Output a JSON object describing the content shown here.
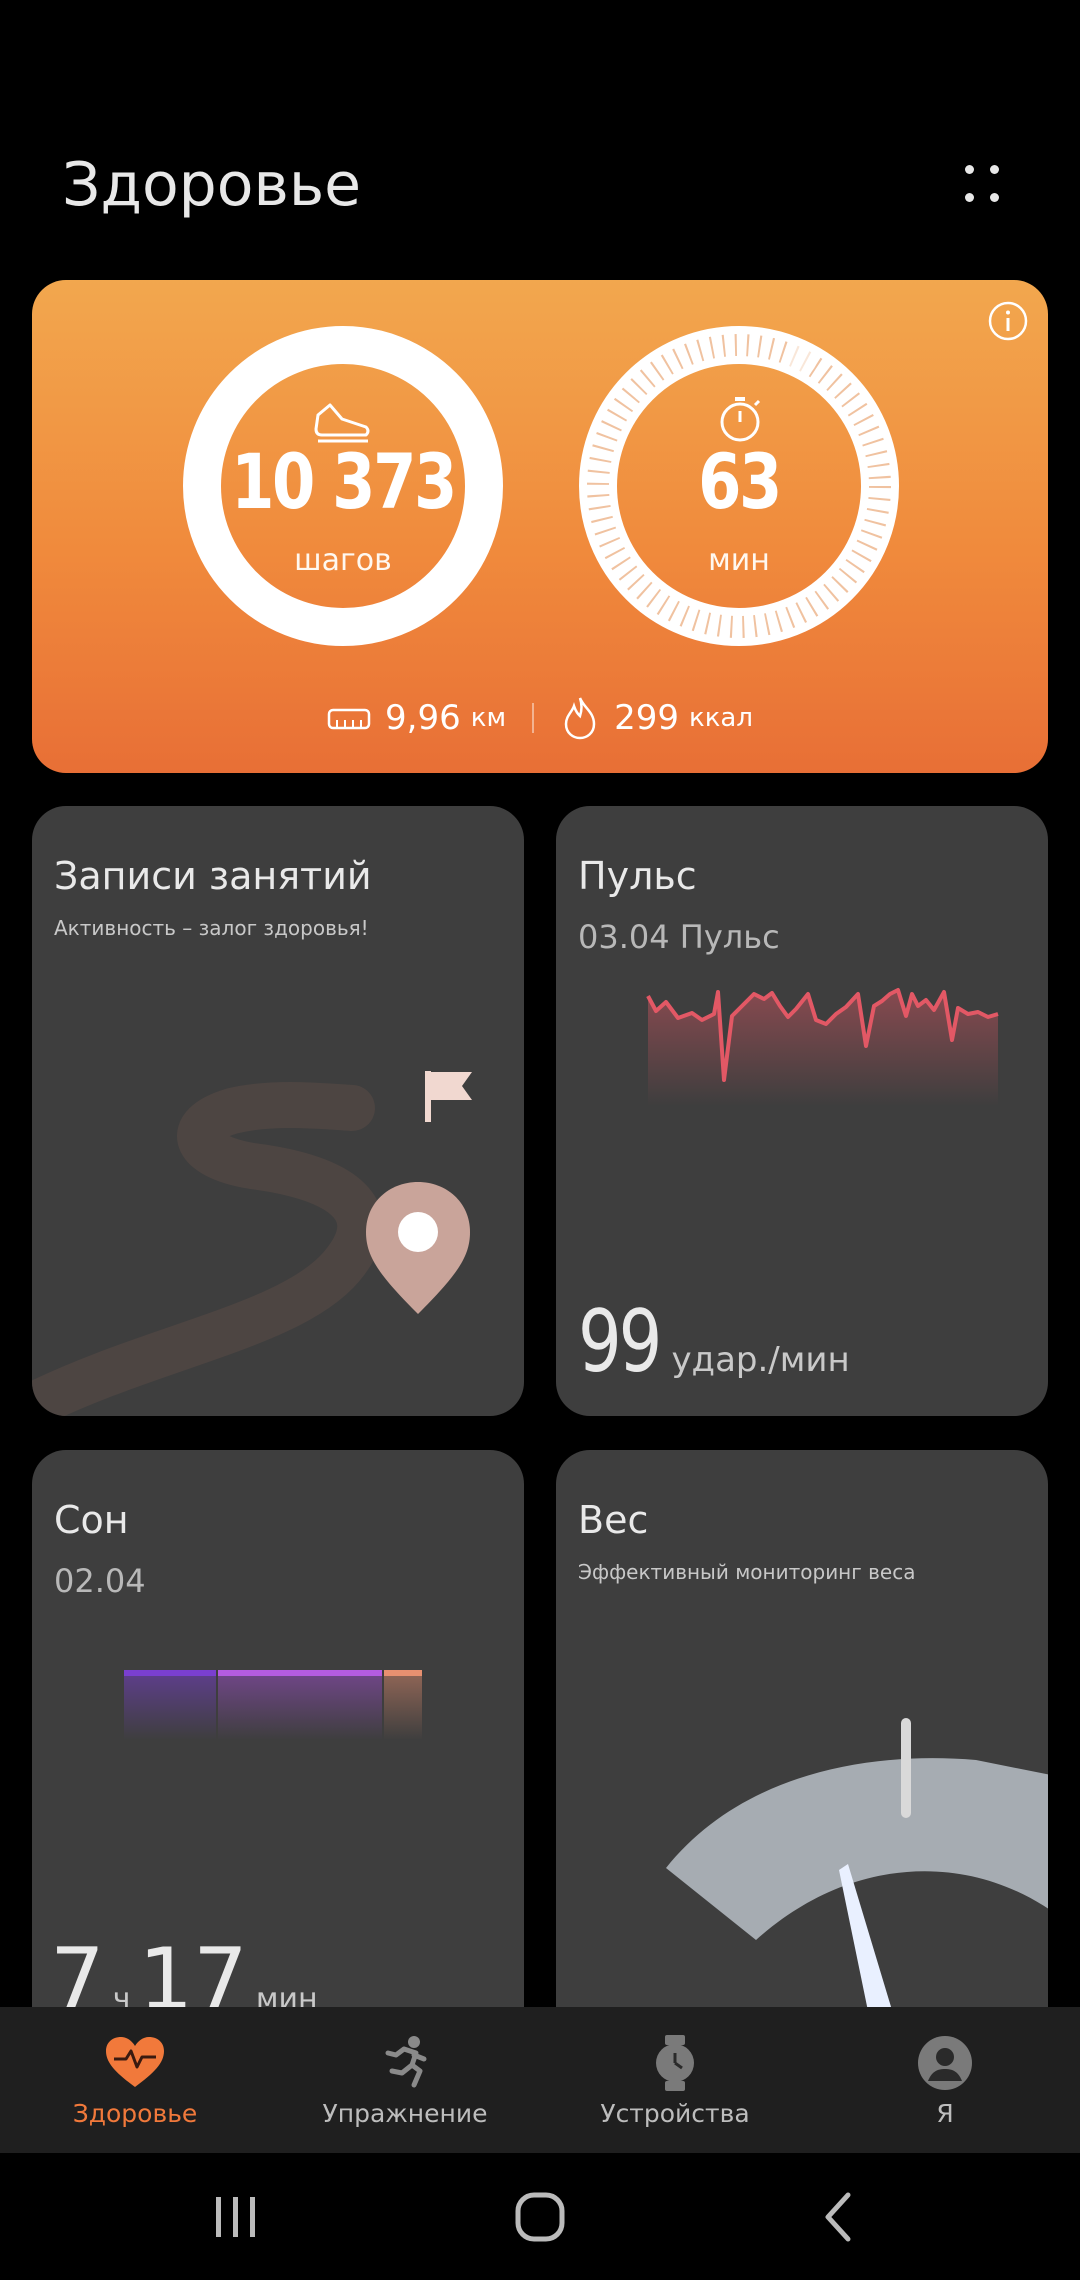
{
  "header": {
    "title": "Здоровье",
    "menu_icon": "more-dots-icon"
  },
  "summary": {
    "steps_value": "10 373",
    "steps_unit": "шагов",
    "minutes_value": "63",
    "minutes_unit": "мин",
    "distance_value": "9,96",
    "distance_unit": "км",
    "calories_value": "299",
    "calories_unit": "ккал",
    "steps_progress": 1.0,
    "minutes_progress": 1.0,
    "accent": "#f08a3c"
  },
  "cards": {
    "workouts": {
      "title": "Записи занятий",
      "subtitle": "Активность – залог здоровья!"
    },
    "pulse": {
      "title": "Пульс",
      "date": "03.04 Пульс",
      "value": "99",
      "unit": "удар./мин"
    },
    "sleep": {
      "title": "Сон",
      "date": "02.04",
      "hours": "7",
      "hours_unit": "ч",
      "minutes": "17",
      "minutes_unit": "мин"
    },
    "weight": {
      "title": "Вес",
      "subtitle": "Эффективный мониторинг веса"
    }
  },
  "nav": {
    "items": [
      {
        "label": "Здоровье",
        "icon": "heart-pulse-icon",
        "active": true
      },
      {
        "label": "Упражнение",
        "icon": "running-icon",
        "active": false
      },
      {
        "label": "Устройства",
        "icon": "watch-icon",
        "active": false
      },
      {
        "label": "Я",
        "icon": "profile-icon",
        "active": false
      }
    ]
  },
  "colors": {
    "active_nav": "#f1793b",
    "pulse_line": "#e25865",
    "sleep_deep": "#7a3fd0",
    "sleep_light": "#a64fd8"
  }
}
